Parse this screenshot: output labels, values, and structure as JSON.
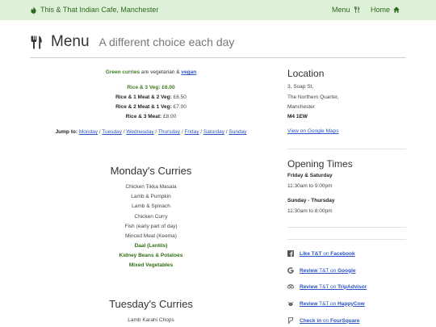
{
  "nav": {
    "brand": "This & That Indian Cafe, Manchester",
    "menu_label": "Menu",
    "home_label": "Home"
  },
  "header": {
    "title": "Menu",
    "subtitle": "A different choice each day"
  },
  "intro": {
    "green_text": "Green curries",
    "middle_text": " are vegetarian & ",
    "vegan_link": "vegan"
  },
  "prices": [
    {
      "label": "Rice & 3 Veg:",
      "amount": "£6.00",
      "green": true
    },
    {
      "label": "Rice & 1 Meat & 2 Veg:",
      "amount": "£6.50",
      "green": false
    },
    {
      "label": "Rice & 2 Meat & 1 Veg:",
      "amount": "£7.00",
      "green": false
    },
    {
      "label": "Rice & 3 Meat:",
      "amount": "£8.00",
      "green": false
    }
  ],
  "jump": {
    "label": "Jump to:",
    "days": [
      "Monday",
      "Tuesday",
      "Wednesday",
      "Thursday",
      "Friday",
      "Saturday",
      "Sunday"
    ]
  },
  "monday": {
    "title": "Monday's Curries",
    "items": [
      {
        "name": "Chicken Tikka Masala",
        "veg": false
      },
      {
        "name": "Lamb & Pumpkin",
        "veg": false
      },
      {
        "name": "Lamb & Spinach",
        "veg": false
      },
      {
        "name": "Chicken Curry",
        "veg": false
      },
      {
        "name": "Fish (early part of day)",
        "veg": false
      },
      {
        "name": "Minced Meat (Keema)",
        "veg": false
      },
      {
        "name": "Daal (Lentils)",
        "veg": true
      },
      {
        "name": "Kidney Beans & Potatoes",
        "veg": true
      },
      {
        "name": "Mixed Vegetables",
        "veg": true
      }
    ]
  },
  "tuesday": {
    "title": "Tuesday's Curries",
    "items": [
      {
        "name": "Lamb Karahi Chops",
        "veg": false
      }
    ]
  },
  "location": {
    "heading": "Location",
    "lines": [
      "3, Soap St,",
      "The Northern Quarter,",
      "Manchester"
    ],
    "postcode": "M4 1EW",
    "map_link": "View on Google Maps"
  },
  "opening": {
    "heading": "Opening Times",
    "slots": [
      {
        "days": "Friday & Saturday",
        "hours": "11:30am to 9:00pm"
      },
      {
        "days": "Sunday - Thursday",
        "hours": "11:30am to 8:00pm"
      }
    ]
  },
  "social": [
    {
      "icon": "facebook-icon",
      "pre": "Like T&T",
      "mid": " on ",
      "service": "Facebook"
    },
    {
      "icon": "google-icon",
      "pre": "Review",
      "mid": " T&T on ",
      "service": "Google"
    },
    {
      "icon": "tripadvisor-icon",
      "pre": "Review",
      "mid": " T&T on ",
      "service": "TripAdvisor"
    },
    {
      "icon": "happycow-icon",
      "pre": "Review",
      "mid": " T&T on ",
      "service": "HappyCow"
    },
    {
      "icon": "foursquare-icon",
      "pre": "Check in",
      "mid": " on ",
      "service": "FourSquare"
    }
  ],
  "colors": {
    "navbar_bg": "#dff0d8",
    "brand_green": "#2d6a1f",
    "veg_green": "#2f6d14",
    "link_blue": "#2b55c4"
  }
}
